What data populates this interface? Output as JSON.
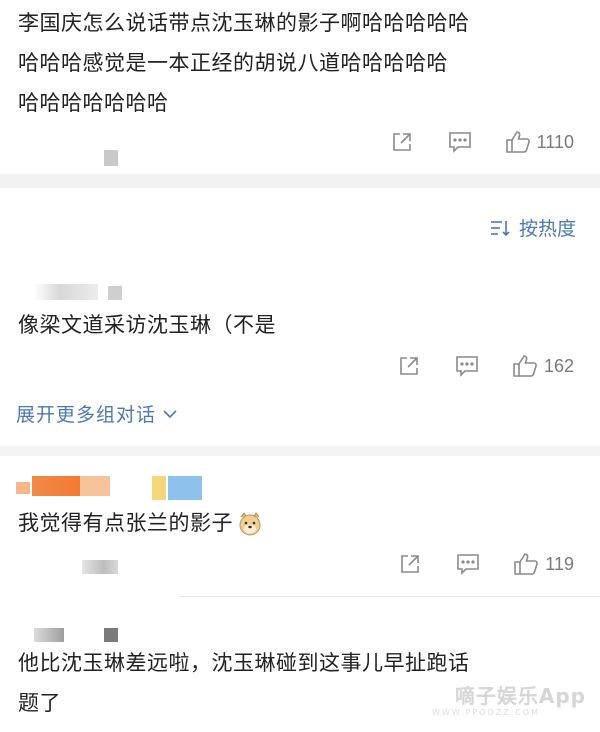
{
  "comments": [
    {
      "lines": [
        "李国庆怎么说话带点沈玉琳的影子啊哈哈哈哈哈",
        "哈哈哈感觉是一本正经的胡说八道哈哈哈哈哈",
        "哈哈哈哈哈哈哈"
      ],
      "likes": "1110"
    },
    {
      "text": "像梁文道采访沈玉琳（不是",
      "likes": "162"
    },
    {
      "text": "我觉得有点张兰的影子",
      "likes": "119"
    },
    {
      "lines": [
        "他比沈玉琳差远啦，沈玉琳碰到这事儿早扯跑话",
        "题了"
      ]
    }
  ],
  "sort": {
    "label": "按热度"
  },
  "expand": {
    "label": "展开更多组对话"
  },
  "watermark": {
    "main": "嘀子娱乐App",
    "sub": "WWW.PPOOZZ.COM"
  },
  "icons": {
    "share": "share-icon",
    "comment": "comment-icon",
    "like": "thumbs-up-icon",
    "sort": "sort-icon",
    "chevron": "chevron-down-icon",
    "emoji": "doge-emoji-icon"
  },
  "colors": {
    "link": "#4a78b8",
    "icon": "#8a8a8a",
    "divider": "#f2f2f2"
  }
}
